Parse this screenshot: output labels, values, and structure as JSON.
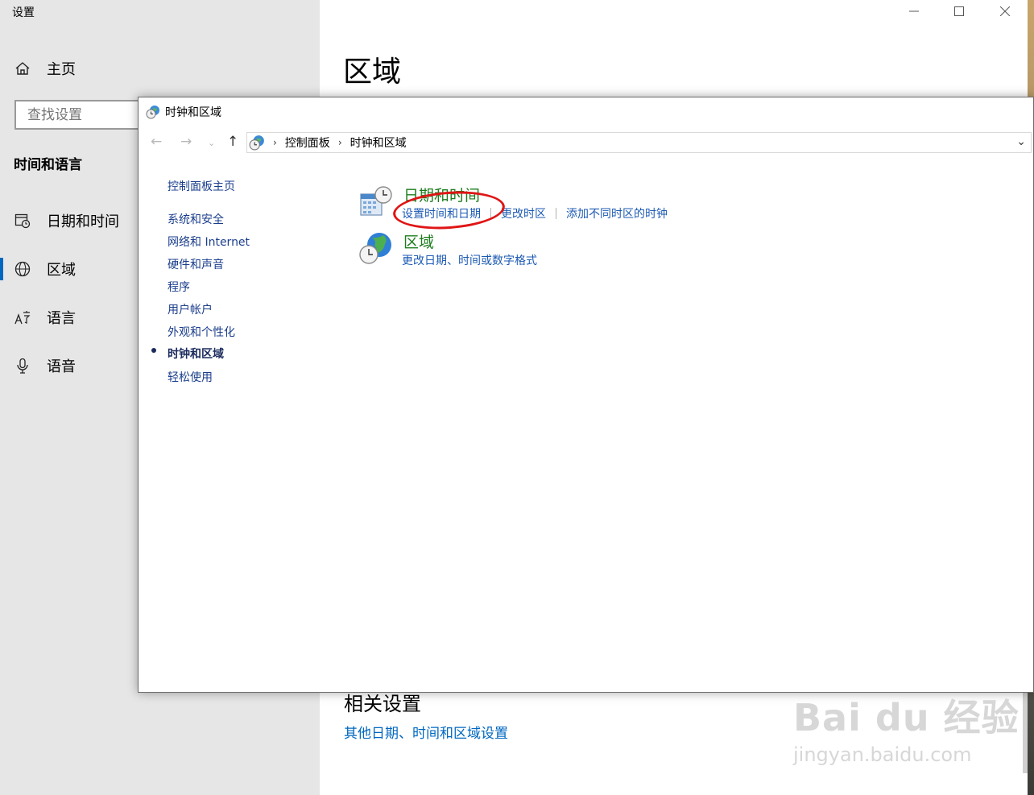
{
  "settings": {
    "window_title": "设置",
    "home_label": "主页",
    "search_placeholder": "查找设置",
    "section_heading": "时间和语言",
    "nav": [
      {
        "label": "日期和时间",
        "icon": "calendar-clock-icon"
      },
      {
        "label": "区域",
        "icon": "globe-icon",
        "selected": true
      },
      {
        "label": "语言",
        "icon": "language-icon"
      },
      {
        "label": "语音",
        "icon": "microphone-icon"
      }
    ],
    "page_title": "区域",
    "related_heading": "相关设置",
    "related_link": "其他日期、时间和区域设置"
  },
  "control_panel": {
    "window_title": "时钟和区域",
    "breadcrumb": [
      "控制面板",
      "时钟和区域"
    ],
    "left_nav": [
      {
        "label": "控制面板主页"
      },
      {
        "label": "系统和安全"
      },
      {
        "label": "网络和 Internet"
      },
      {
        "label": "硬件和声音"
      },
      {
        "label": "程序"
      },
      {
        "label": "用户帐户"
      },
      {
        "label": "外观和个性化"
      },
      {
        "label": "时钟和区域",
        "active": true
      },
      {
        "label": "轻松使用"
      }
    ],
    "categories": [
      {
        "title": "日期和时间",
        "icon": "date-time-icon",
        "links": [
          "设置时间和日期",
          "更改时区",
          "添加不同时区的时钟"
        ]
      },
      {
        "title": "区域",
        "icon": "region-globe-icon",
        "links": [
          "更改日期、时间或数字格式"
        ]
      }
    ]
  },
  "annotation": {
    "color": "#e01515"
  },
  "watermark": {
    "brand": "Bai du 经验",
    "url": "jingyan.baidu.com"
  }
}
